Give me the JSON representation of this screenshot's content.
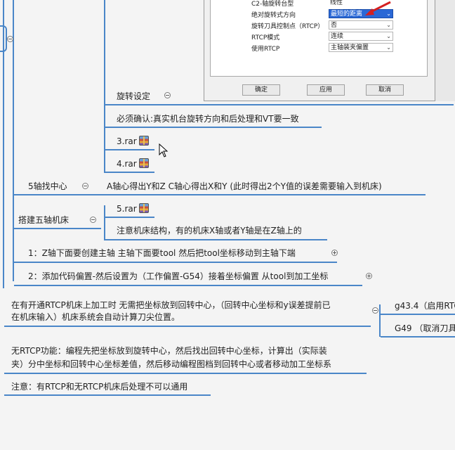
{
  "dialog": {
    "rows": [
      {
        "label": "C2-轴旋转台型",
        "value": "线性"
      },
      {
        "label": "绝对旋转式方向",
        "value": "最短的距离"
      },
      {
        "label": "旋转刀具控制点（RTCP）",
        "value": "否"
      },
      {
        "label": "RTCP模式",
        "value": "连续"
      },
      {
        "label": "使用RTCP",
        "value": "主轴装夹偏置"
      }
    ],
    "ok_label": "确定",
    "apply_label": "应用",
    "cancel_label": "取消"
  },
  "mindmap": {
    "rotation_settings": "旋转设定",
    "must_confirm": "必须确认:真实机台旋转方向和后处理和VT要一致",
    "file_3": "3.rar",
    "file_4": "4.rar",
    "five_axis_center": "5轴找中心",
    "five_axis_center_note": "A轴心得出Y和Z C轴心得出X和Y   (此时得出2个Y值的误差需要输入到机床)",
    "build_machine": "搭建五轴机床",
    "file_5": "5.rar",
    "machine_note": "注意机床结构，有的机床X轴或者Y轴是在Z轴上的",
    "step_1": "1：Z轴下面要创建主轴 主轴下面要tool  然后把tool坐标移动到主轴下端",
    "step_2": "2：添加代码偏置-然后设置为（工作偏置-G54）接着坐标偏置 从tool到加工坐标",
    "rtcp_note_line1": "在有开通RTCP机床上加工时 无需把坐标放到回转中心，（回转中心坐标和y误差提前已",
    "rtcp_note_line2": "在机床输入）机床系统会自动计算刀尖位置。",
    "g434": "g43.4（启用RTC",
    "g49": "G49 （取消刀具",
    "no_rtcp_line1": "无RTCP功能：编程先把坐标放到旋转中心，然后找出回转中心坐标，计算出（实际装",
    "no_rtcp_line2": "夹）分中坐标和回转中心坐标差值，然后移动编程图档到回转中心或者移动加工坐标系",
    "attention": "注意：有RTCP和无RTCP机床后处理不可以通用"
  }
}
